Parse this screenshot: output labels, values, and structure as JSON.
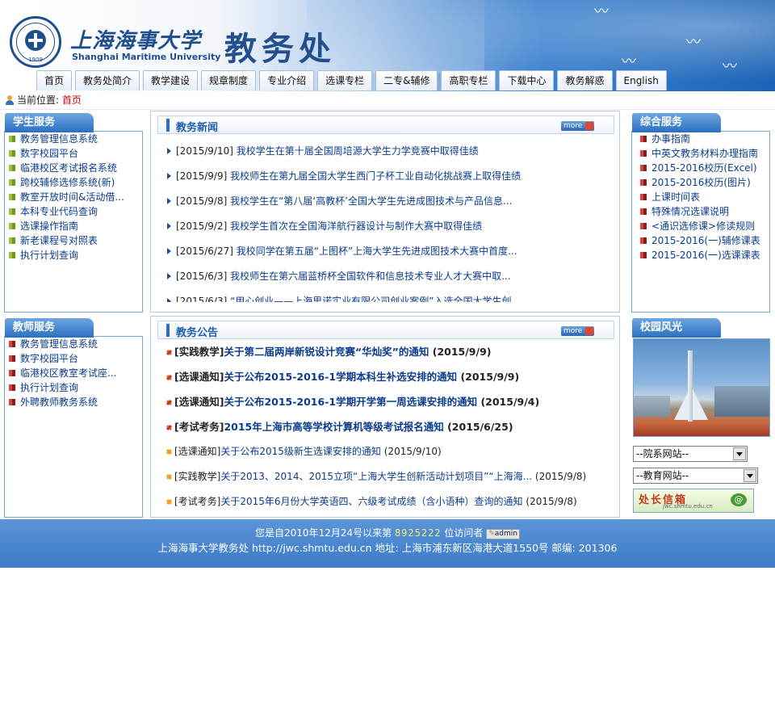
{
  "header": {
    "title_cn": "上海海事大学",
    "title_en": "Shanghai Maritime University",
    "title_big": "教务处",
    "logo_year": "1909"
  },
  "nav": [
    {
      "label": "首页"
    },
    {
      "label": "教务处简介"
    },
    {
      "label": "教学建设"
    },
    {
      "label": "规章制度"
    },
    {
      "label": "专业介绍"
    },
    {
      "label": "选课专栏"
    },
    {
      "label": "二专&辅修"
    },
    {
      "label": "高职专栏"
    },
    {
      "label": "下载中心"
    },
    {
      "label": "教务解惑"
    },
    {
      "label": "English"
    }
  ],
  "location": {
    "label": "当前位置:",
    "value": "首页"
  },
  "student_services": {
    "title": "学生服务",
    "items": [
      {
        "label": "教务管理信息系统",
        "icon": "green-square"
      },
      {
        "label": "数字校园平台",
        "icon": "green-square"
      },
      {
        "label": "临港校区考试报名系统",
        "icon": "green-square"
      },
      {
        "label": "跨校辅修选修系统(新)",
        "icon": "green-square"
      },
      {
        "label": "教室开放时间&活动借...",
        "icon": "green-square"
      },
      {
        "label": "本科专业代码查询",
        "icon": "green-square"
      },
      {
        "label": "选课操作指南",
        "icon": "green-square"
      },
      {
        "label": "新老课程号对照表",
        "icon": "green-square"
      },
      {
        "label": "执行计划查询",
        "icon": "green-square"
      }
    ]
  },
  "teacher_services": {
    "title": "教师服务",
    "items": [
      {
        "label": "教务管理信息系统",
        "icon": "red-square"
      },
      {
        "label": "数字校园平台",
        "icon": "red-square"
      },
      {
        "label": "临港校区教室考试座...",
        "icon": "red-square"
      },
      {
        "label": "执行计划查询",
        "icon": "red-square"
      },
      {
        "label": "外聘教师教务系统",
        "icon": "red-square"
      }
    ]
  },
  "news": {
    "title": "教务新闻",
    "more": "more",
    "items": [
      {
        "date": "[2015/9/10]",
        "text": "我校学生在第十届全国周培源大学生力学竞赛中取得佳绩"
      },
      {
        "date": "[2015/9/9]",
        "text": "我校师生在第九届全国大学生西门子杯工业自动化挑战赛上取得佳绩"
      },
      {
        "date": "[2015/9/8]",
        "text": "我校学生在“第八届‘高教杯’全国大学生先进成图技术与产品信息..."
      },
      {
        "date": "[2015/9/2]",
        "text": "我校学生首次在全国海洋航行器设计与制作大赛中取得佳绩"
      },
      {
        "date": "[2015/6/27]",
        "text": "我校同学在第五届“上图杯”上海大学生先进成图技术大赛中首度..."
      },
      {
        "date": "[2015/6/3]",
        "text": "我校师生在第六届蓝桥杯全国软件和信息技术专业人才大赛中取..."
      },
      {
        "date": "[2015/6/3]",
        "text": "“用心创业——上海思诺实业有限公司创业案例”入选全国大学生创..."
      }
    ]
  },
  "notices": {
    "title": "教务公告",
    "more": "more",
    "items": [
      {
        "cat": "[实践教学]",
        "text": "关于第二届两岸新锐设计竞赛“华灿奖”的通知",
        "date": "(2015/9/9)",
        "bold": true
      },
      {
        "cat": "[选课通知]",
        "text": "关于公布2015-2016-1学期本科生补选安排的通知",
        "date": "(2015/9/9)",
        "bold": true
      },
      {
        "cat": "[选课通知]",
        "text": "关于公布2015-2016-1学期开学第一周选课安排的通知",
        "date": "(2015/9/4)",
        "bold": true
      },
      {
        "cat": "[考试考务]",
        "text": "2015年上海市高等学校计算机等级考试报名通知",
        "date": "(2015/6/25)",
        "bold": true
      },
      {
        "cat": "[选课通知]",
        "text": "关于公布2015级新生选课安排的通知",
        "date": "(2015/9/10)",
        "bold": false
      },
      {
        "cat": "[实践教学]",
        "text": "关于2013、2014、2015立项“上海大学生创新活动计划项目”“上海海...",
        "date": "(2015/9/8)",
        "bold": false
      },
      {
        "cat": "[考试考务]",
        "text": "关于2015年6月份大学英语四、六级考试成绩（含小语种）查询的通知",
        "date": "(2015/9/8)",
        "bold": false
      }
    ]
  },
  "general_services": {
    "title": "综合服务",
    "items": [
      {
        "label": "办事指南",
        "icon": "red-square"
      },
      {
        "label": "中英文教务材料办理指南",
        "icon": "red-square"
      },
      {
        "label": "2015-2016校历(Excel)",
        "icon": "red-square"
      },
      {
        "label": "2015-2016校历(图片)",
        "icon": "red-square"
      },
      {
        "label": "上课时间表",
        "icon": "red-square"
      },
      {
        "label": "特殊情况选课说明",
        "icon": "red-square"
      },
      {
        "label": "<通识选修课>修读规则",
        "icon": "red-square"
      },
      {
        "label": "2015-2016(一)辅修课表",
        "icon": "red-square"
      },
      {
        "label": "2015-2016(一)选课课表",
        "icon": "red-square"
      }
    ]
  },
  "campus": {
    "title": "校园风光"
  },
  "selects": {
    "college": "--院系网站--",
    "education": "--教育网站--"
  },
  "mailbox": {
    "title": "处长信箱",
    "url": "jwc.shmtu.edu.cn"
  },
  "footer": {
    "line1_pre": "您是自2010年12月24号以来第",
    "count": "8925222",
    "line1_post": "位访问者",
    "admin": "admin",
    "line2": "上海海事大学教务处 http://jwc.shmtu.edu.cn 地址: 上海市浦东新区海港大道1550号 邮编: 201306"
  },
  "colors": {
    "primary": "#2a6fc0",
    "link": "#0b3c8c",
    "accent_red": "#d40000",
    "footer_bg": "#4a88d0"
  }
}
